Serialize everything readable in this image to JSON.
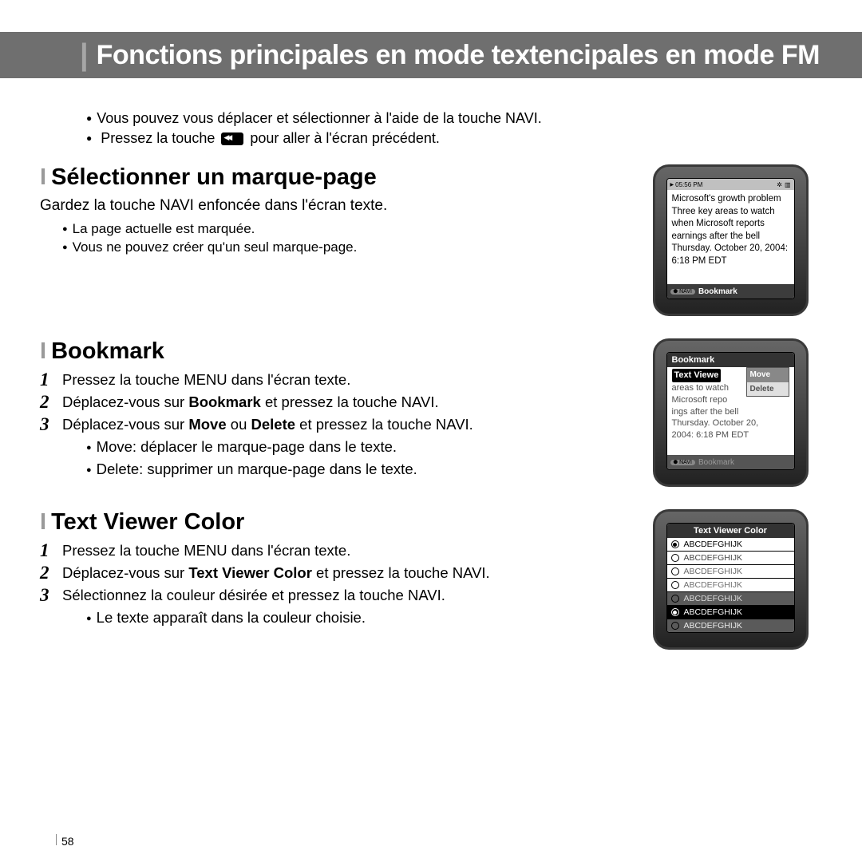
{
  "title": "Fonctions principales en mode textencipales en mode FM",
  "intro": {
    "line1": "Vous pouvez vous déplacer et sélectionner à l'aide de la touche NAVI.",
    "line2_a": "Pressez la touche ",
    "line2_b": " pour aller à l'écran précédent."
  },
  "section1": {
    "heading": "Sélectionner un marque-page",
    "sub": "Gardez la touche NAVI enfoncée dans l'écran texte.",
    "b1": "La page actuelle est marquée.",
    "b2": "Vous ne pouvez créer qu'un seul marque-page."
  },
  "section2": {
    "heading": "Bookmark",
    "s1": "Pressez la touche MENU dans l'écran texte.",
    "s2_a": "Déplacez-vous sur ",
    "s2_bold": "Bookmark",
    "s2_b": " et pressez la touche NAVI.",
    "s3_a": "Déplacez-vous sur ",
    "s3_bold1": "Move",
    "s3_mid": " ou ",
    "s3_bold2": "Delete",
    "s3_b": " et pressez la touche NAVI.",
    "b1": "Move: déplacer le marque-page dans le texte.",
    "b2": "Delete: supprimer un marque-page dans le texte."
  },
  "section3": {
    "heading": "Text Viewer Color",
    "s1": "Pressez la touche MENU dans l'écran texte.",
    "s2_a": "Déplacez-vous sur ",
    "s2_bold": "Text Viewer Color",
    "s2_b": " et pressez la touche NAVI.",
    "s3": "Sélectionnez la couleur désirée et pressez la touche NAVI.",
    "b1": "Le texte apparaît dans la couleur choisie."
  },
  "device1": {
    "time": "05:56 PM",
    "body": "Microsoft's growth problem Three key areas to watch when Microsoft reports earnings after the bell Thursday. October 20, 2004: 6:18 PM EDT",
    "navi": "NAVI",
    "footer": "Bookmark"
  },
  "device2": {
    "header": "Bookmark",
    "row1": "Text Viewe",
    "body_rest": "areas to watch\nMicrosoft repo\nings after the bell\nThursday. October 20,\n2004: 6:18 PM EDT",
    "popup_move": "Move",
    "popup_delete": "Delete",
    "navi": "NAVI",
    "footer": "Bookmark"
  },
  "device3": {
    "header": "Text Viewer Color",
    "sample": "ABCDEFGHIJK"
  },
  "page_number": "58"
}
